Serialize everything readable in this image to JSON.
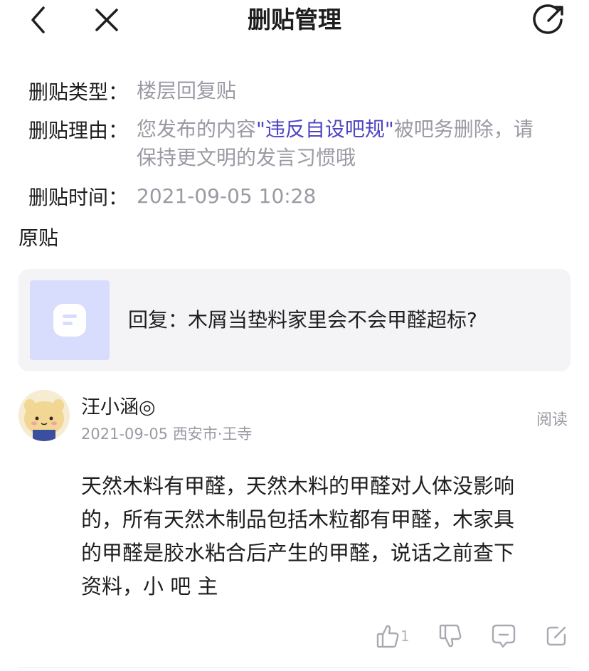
{
  "nav": {
    "title": "删贴管理"
  },
  "info": {
    "type_label": "删贴类型：",
    "type_value": "楼层回复贴",
    "reason_label": "删贴理由：",
    "reason_prefix": "您发布的内容",
    "reason_highlight": "\"违反自设吧规\"",
    "reason_suffix_line1": "被吧务删除，请",
    "reason_line2": "保持更文明的发言习惯哦",
    "time_label": "删贴时间：",
    "time_value": "2021-09-05 10:28"
  },
  "original": {
    "section_title": "原贴",
    "post_text": "回复：木屑当垫料家里会不会甲醛超标?"
  },
  "comment": {
    "username": "汪小涵◎",
    "meta": "2021-09-05 西安市·王寺",
    "read_label": "阅读",
    "lines": [
      "天然木料有甲醛，天然木料的甲醛对人体没影响",
      "的，所有天然木制品包括木粒都有甲醛，木家具",
      "的甲醛是胶水粘合后产生的甲醛，说话之前查下",
      "资料，小 吧 主"
    ],
    "like_count": "1"
  },
  "colors": {
    "accent": "#4f45c2",
    "muted": "#999aa3",
    "card_bg": "#f4f4f7",
    "thumb_bg": "#d8dcfd"
  }
}
